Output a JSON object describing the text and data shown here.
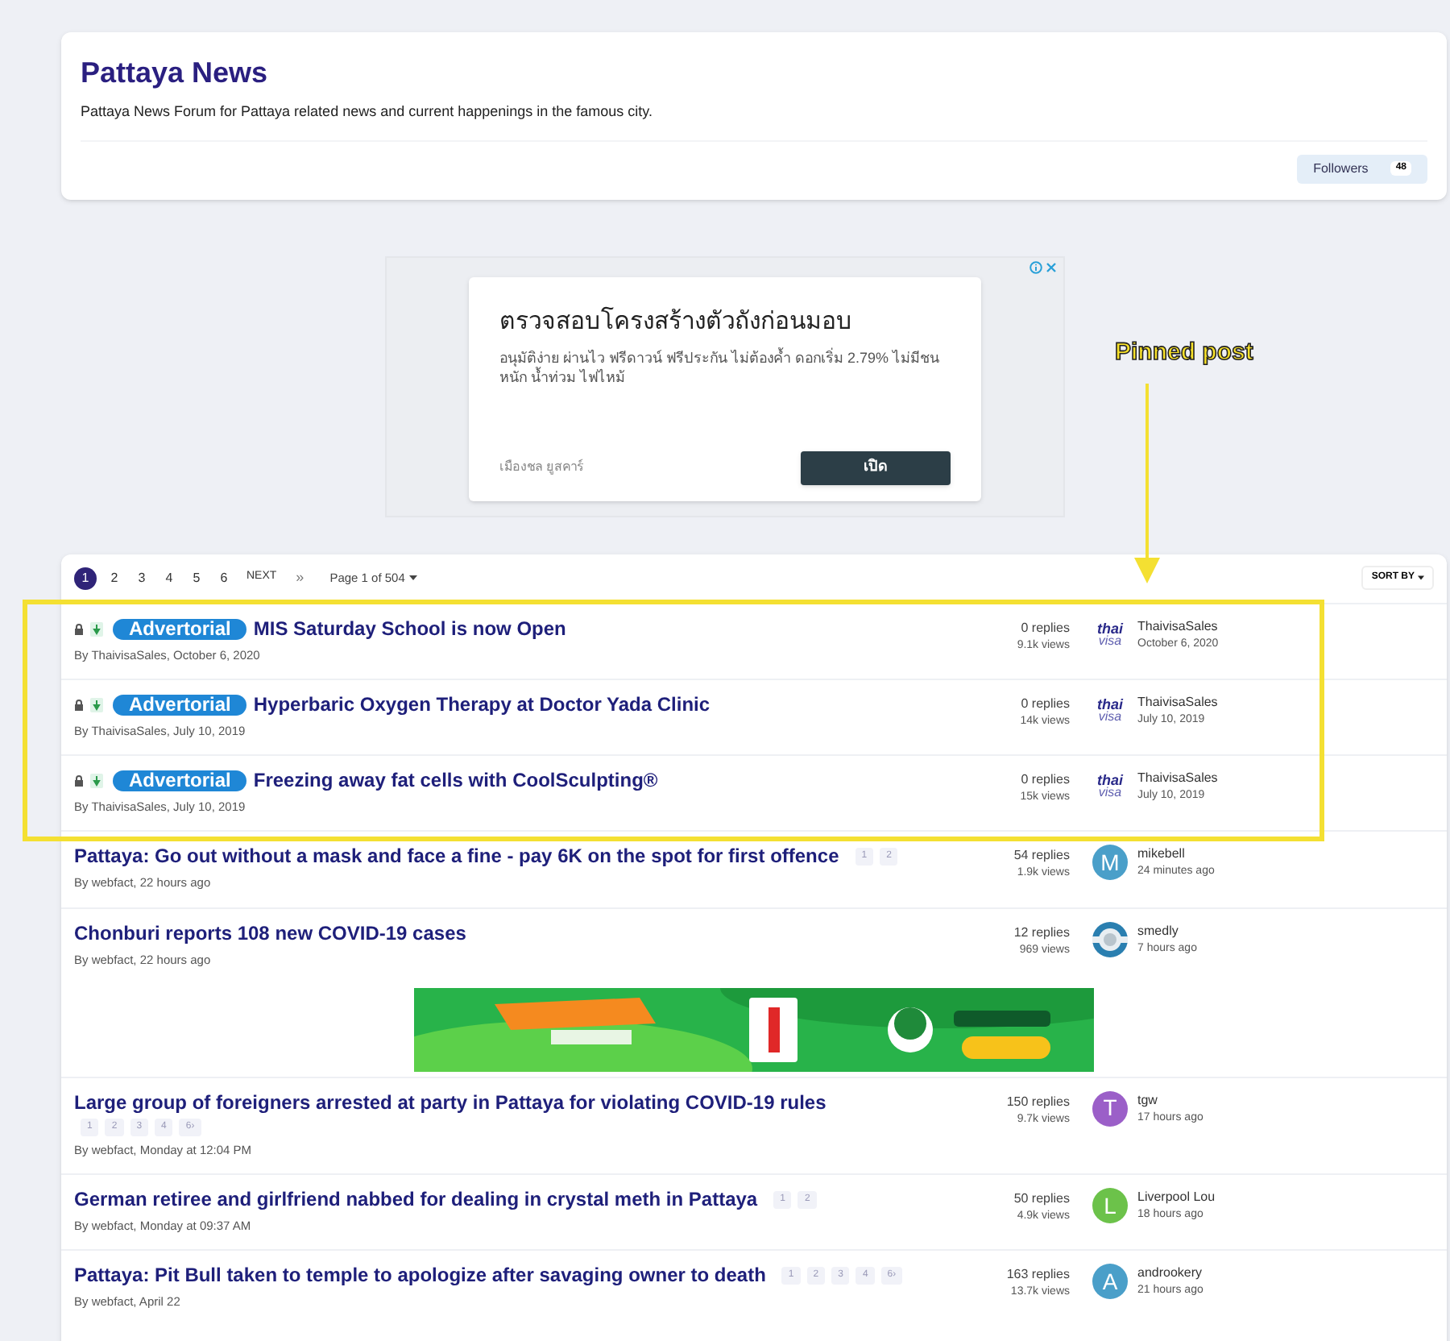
{
  "forum": {
    "title": "Pattaya News",
    "description": "Pattaya News Forum for Pattaya related news and current happenings in the famous city.",
    "followers_label": "Followers",
    "followers_count": "48"
  },
  "ad": {
    "headline": "ตรวจสอบโครงสร้างตัวถังก่อนมอบ",
    "body": "อนุมัติง่าย ผ่านไว ฟรีดาวน์ ฟรีประกัน ไม่ต้องค้ำ ดอกเริ่ม 2.79% ไม่มีชน หนัก น้ำท่วม ไฟไหม้",
    "advertiser": "เมืองชล ยูสคาร์",
    "button": "เปิด"
  },
  "pagination": {
    "pages": [
      {
        "label": "1",
        "selected": true
      },
      {
        "label": "2",
        "selected": false
      },
      {
        "label": "3",
        "selected": false
      },
      {
        "label": "4",
        "selected": false
      },
      {
        "label": "5",
        "selected": false
      },
      {
        "label": "6",
        "selected": false
      }
    ],
    "next": "NEXT",
    "last": "»",
    "page_info": "Page 1 of 504",
    "sort": "SORT BY"
  },
  "topics": [
    {
      "kind": "topic",
      "locked": true,
      "pinned": true,
      "badge": "Advertorial",
      "title": "MIS Saturday School is now Open",
      "byline": "By ThaivisaSales, October 6, 2020",
      "replies": "0 replies",
      "views": "9.1k views",
      "avatar": {
        "kind": "logo",
        "top": "thai",
        "bottom": "visa"
      },
      "last_poster": "ThaivisaSales",
      "last_time": "October 6, 2020"
    },
    {
      "kind": "topic",
      "locked": true,
      "pinned": true,
      "badge": "Advertorial",
      "title": "Hyperbaric Oxygen Therapy at Doctor Yada Clinic",
      "byline": "By ThaivisaSales, July 10, 2019",
      "replies": "0 replies",
      "views": "14k views",
      "avatar": {
        "kind": "logo",
        "top": "thai",
        "bottom": "visa"
      },
      "last_poster": "ThaivisaSales",
      "last_time": "July 10, 2019"
    },
    {
      "kind": "topic",
      "locked": true,
      "pinned": true,
      "badge": "Advertorial",
      "title": "Freezing away fat cells with CoolSculpting®",
      "byline": "By ThaivisaSales, July 10, 2019",
      "replies": "0 replies",
      "views": "15k views",
      "avatar": {
        "kind": "logo",
        "top": "thai",
        "bottom": "visa"
      },
      "last_poster": "ThaivisaSales",
      "last_time": "July 10, 2019"
    },
    {
      "kind": "topic",
      "locked": false,
      "pinned": false,
      "title": "Pattaya: Go out without a mask and face a fine - pay 6K on the spot for first offence",
      "byline": "By webfact, 22 hours ago",
      "pages": [
        "1",
        "2"
      ],
      "replies": "54 replies",
      "views": "1.9k views",
      "avatar": {
        "kind": "letter",
        "letter": "M",
        "color": "#4a9fc9"
      },
      "last_poster": "mikebell",
      "last_time": "24 minutes ago"
    },
    {
      "kind": "topic",
      "locked": false,
      "pinned": false,
      "title": "Chonburi reports 108 new COVID-19 cases",
      "byline": "By webfact, 22 hours ago",
      "replies": "12 replies",
      "views": "969 views",
      "last_poster": "smedly",
      "last_time": "7 hours ago"
    },
    {
      "kind": "banner"
    },
    {
      "kind": "topic",
      "locked": false,
      "pinned": false,
      "title": "Large group of foreigners arrested at party in Pattaya for violating COVID-19 rules",
      "byline": "By webfact, Monday at 12:04 PM",
      "pages": [
        "1",
        "2",
        "3",
        "4",
        "6›"
      ],
      "replies": "150 replies",
      "views": "9.7k views",
      "avatar": {
        "kind": "letter",
        "letter": "T",
        "color": "#9b5fc8"
      },
      "last_poster": "tgw",
      "last_time": "17 hours ago"
    },
    {
      "kind": "topic",
      "locked": false,
      "pinned": false,
      "title": "German retiree and girlfriend nabbed for dealing in crystal meth in Pattaya",
      "byline": "By webfact, Monday at 09:37 AM",
      "pages": [
        "1",
        "2"
      ],
      "replies": "50 replies",
      "views": "4.9k views",
      "avatar": {
        "kind": "letter",
        "letter": "L",
        "color": "#6cc24a"
      },
      "last_poster": "Liverpool Lou",
      "last_time": "18 hours ago"
    },
    {
      "kind": "topic",
      "locked": false,
      "pinned": false,
      "title": "Pattaya: Pit Bull taken to temple to apologize after savaging owner to death",
      "byline": "By webfact, April 22",
      "pages": [
        "1",
        "2",
        "3",
        "4",
        "6›"
      ],
      "replies": "163 replies",
      "views": "13.7k views",
      "avatar": {
        "kind": "letter",
        "letter": "A",
        "color": "#4a9fc9"
      },
      "last_poster": "androokery",
      "last_time": "21 hours ago"
    }
  ],
  "annotation": {
    "label": "Pinned post"
  }
}
